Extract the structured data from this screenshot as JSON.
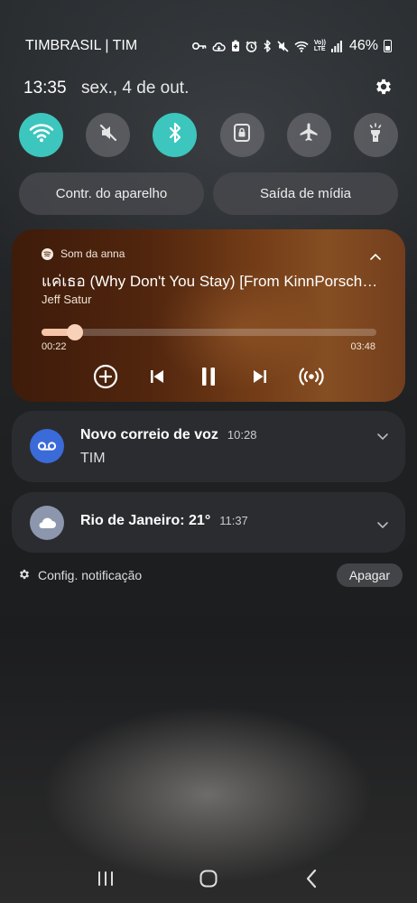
{
  "status_bar": {
    "carrier": "TIMBRASIL | TIM",
    "battery_percent": "46%",
    "network_label_top": "Vo))",
    "network_label_bottom": "LTE",
    "icons": [
      "key-icon",
      "vpn-cloud-icon",
      "battery-saver-icon",
      "alarm-icon",
      "bluetooth-icon",
      "mute-icon",
      "wifi-icon",
      "volte-icon",
      "signal-icon",
      "battery-icon"
    ]
  },
  "header": {
    "time": "13:35",
    "date": "sex., 4 de out.",
    "settings_icon": "gear-icon"
  },
  "quick_settings": [
    {
      "name": "wifi",
      "icon": "wifi-icon",
      "active": true
    },
    {
      "name": "sound",
      "icon": "mute-icon",
      "active": false
    },
    {
      "name": "bluetooth",
      "icon": "bluetooth-icon",
      "active": true
    },
    {
      "name": "screen-lock",
      "icon": "lock-icon",
      "active": false
    },
    {
      "name": "airplane",
      "icon": "airplane-icon",
      "active": false
    },
    {
      "name": "flashlight",
      "icon": "flashlight-icon",
      "active": false
    }
  ],
  "pills": {
    "device_control": "Contr. do aparelho",
    "media_output": "Saída de mídia"
  },
  "media": {
    "app_label": "Som da anna",
    "title": "แค่เธอ (Why Don't You Stay) [From KinnPorsche The Series]",
    "artist": "Jeff Satur",
    "elapsed": "00:22",
    "total": "03:48",
    "progress": 0.1,
    "colors": {
      "fill": "#f6c5a8",
      "thumb": "#f8d1b8"
    }
  },
  "notifications": [
    {
      "title": "Novo correio de voz",
      "time": "10:28",
      "body": "TIM",
      "icon": "voicemail-icon",
      "icon_color": "#3b6ad9"
    },
    {
      "title": "Rio de Janeiro: 21°",
      "time": "11:37",
      "icon": "cloud-icon",
      "icon_color": "#8c97ad"
    }
  ],
  "footer": {
    "settings_label": "Config. notificação",
    "clear_label": "Apagar"
  },
  "nav": [
    "recents-icon",
    "home-icon",
    "back-icon"
  ],
  "colors": {
    "accent": "#3cc6bd"
  }
}
